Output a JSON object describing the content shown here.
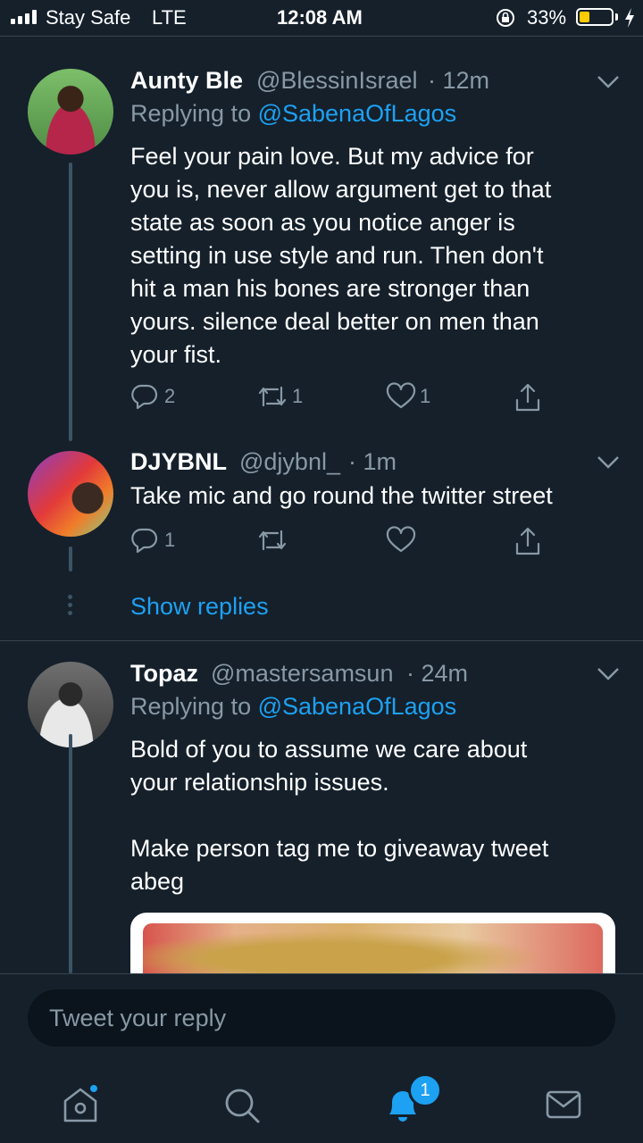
{
  "status_bar": {
    "carrier": "Stay Safe",
    "network": "LTE",
    "time": "12:08 AM",
    "battery": "33%",
    "battery_level": 0.33,
    "battery_color": "#ffcc00"
  },
  "tweets": [
    {
      "name": "Aunty Ble",
      "handle": "@BlessinIsrael",
      "time": "· 12m",
      "replying_prefix": "Replying to ",
      "replying_to": "@SabenaOfLagos",
      "text": "Feel your pain love. But my advice for\nyou is, never allow argument get to that\nstate as soon as you notice anger is\nsetting in use style and run. Then don't\nhit a man his bones are stronger than\nyours. silence deal better on men than\nyour fist.",
      "replies": "2",
      "retweets": "1",
      "likes": "1"
    },
    {
      "name": "DJYBNL",
      "handle": "@djybnl_",
      "time": "· 1m",
      "text": "Take mic and go round the twitter street",
      "replies": "1",
      "retweets": "",
      "likes": ""
    },
    {
      "name": "Topaz",
      "handle": "@mastersamsun",
      "time": "· 24m",
      "replying_prefix": "Replying to ",
      "replying_to": "@SabenaOfLagos",
      "text": "Bold of you to assume we care about\nyour relationship issues.\n\nMake person tag me to giveaway tweet\nabeg"
    }
  ],
  "show_replies": "Show replies",
  "reply_placeholder": "Tweet your reply",
  "tabs": {
    "notifications_badge": "1",
    "icons": [
      "home-icon",
      "search-icon",
      "notifications-icon",
      "messages-icon"
    ]
  },
  "colors": {
    "background": "#15202b",
    "accent": "#1da1f2",
    "muted": "#8899a6",
    "divider": "#38444d"
  }
}
